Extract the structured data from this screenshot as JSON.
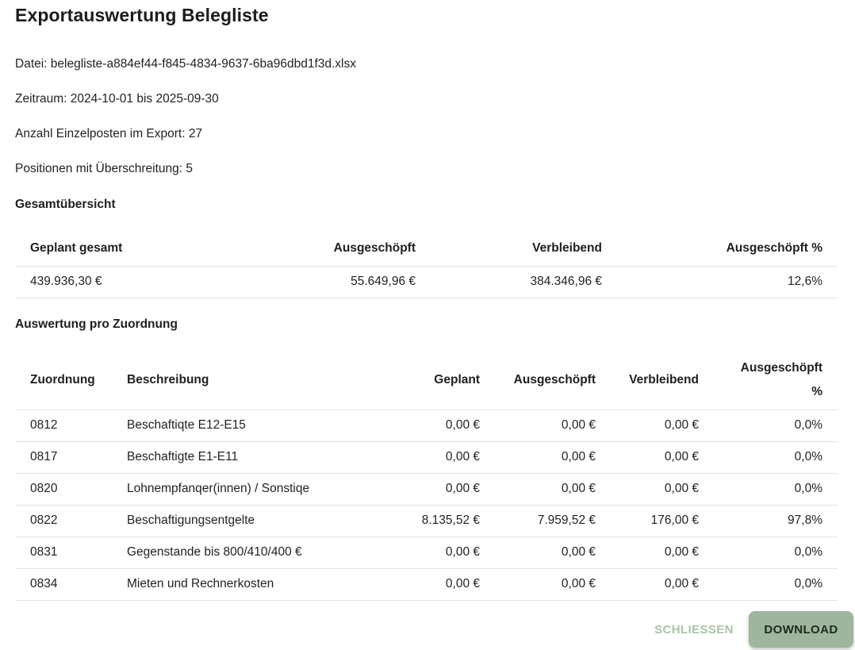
{
  "dialog": {
    "title": "Exportauswertung Belegliste",
    "file_line": "Datei: belegliste-a884ef44-f845-4834-9637-6ba96dbd1f3d.xlsx",
    "period_line": "Zeitraum: 2024-10-01 bis 2025-09-30",
    "count_line": "Anzahl Einzelposten im Export: 27",
    "overrun_line": "Positionen mit Überschreitung: 5"
  },
  "summary": {
    "section_title": "Gesamtübersicht",
    "headers": [
      "Geplant gesamt",
      "Ausgeschöpft",
      "Verbleibend",
      "Ausgeschöpft %"
    ],
    "row": [
      "439.936,30 €",
      "55.649,96 €",
      "384.346,96 €",
      "12,6%"
    ]
  },
  "detail": {
    "section_title": "Auswertung pro Zuordnung",
    "headers": [
      "Zuordnung",
      "Beschreibung",
      "Geplant",
      "Ausgeschöpft",
      "Verbleibend",
      "Ausgeschöpft %"
    ],
    "rows": [
      [
        "0812",
        "Beschaftiqte E12-E15",
        "0,00 €",
        "0,00 €",
        "0,00 €",
        "0,0%"
      ],
      [
        "0817",
        "Beschaftigte E1-E11",
        "0,00 €",
        "0,00 €",
        "0,00 €",
        "0,0%"
      ],
      [
        "0820",
        "Lohnempfanqer(innen) / Sonstiqe",
        "0,00 €",
        "0,00 €",
        "0,00 €",
        "0,0%"
      ],
      [
        "0822",
        "Beschaftigungsentgelte",
        "8.135,52 €",
        "7.959,52 €",
        "176,00 €",
        "97,8%"
      ],
      [
        "0831",
        "Gegenstande bis 800/410/400 €",
        "0,00 €",
        "0,00 €",
        "0,00 €",
        "0,0%"
      ],
      [
        "0834",
        "Mieten und Rechnerkosten",
        "0,00 €",
        "0,00 €",
        "0,00 €",
        "0,0%"
      ]
    ]
  },
  "actions": {
    "close_label": "SCHLIESSEN",
    "download_label": "DOWNLOAD"
  },
  "colors": {
    "download_bg": "#9eb69d",
    "close_text": "#a8c4a6"
  }
}
